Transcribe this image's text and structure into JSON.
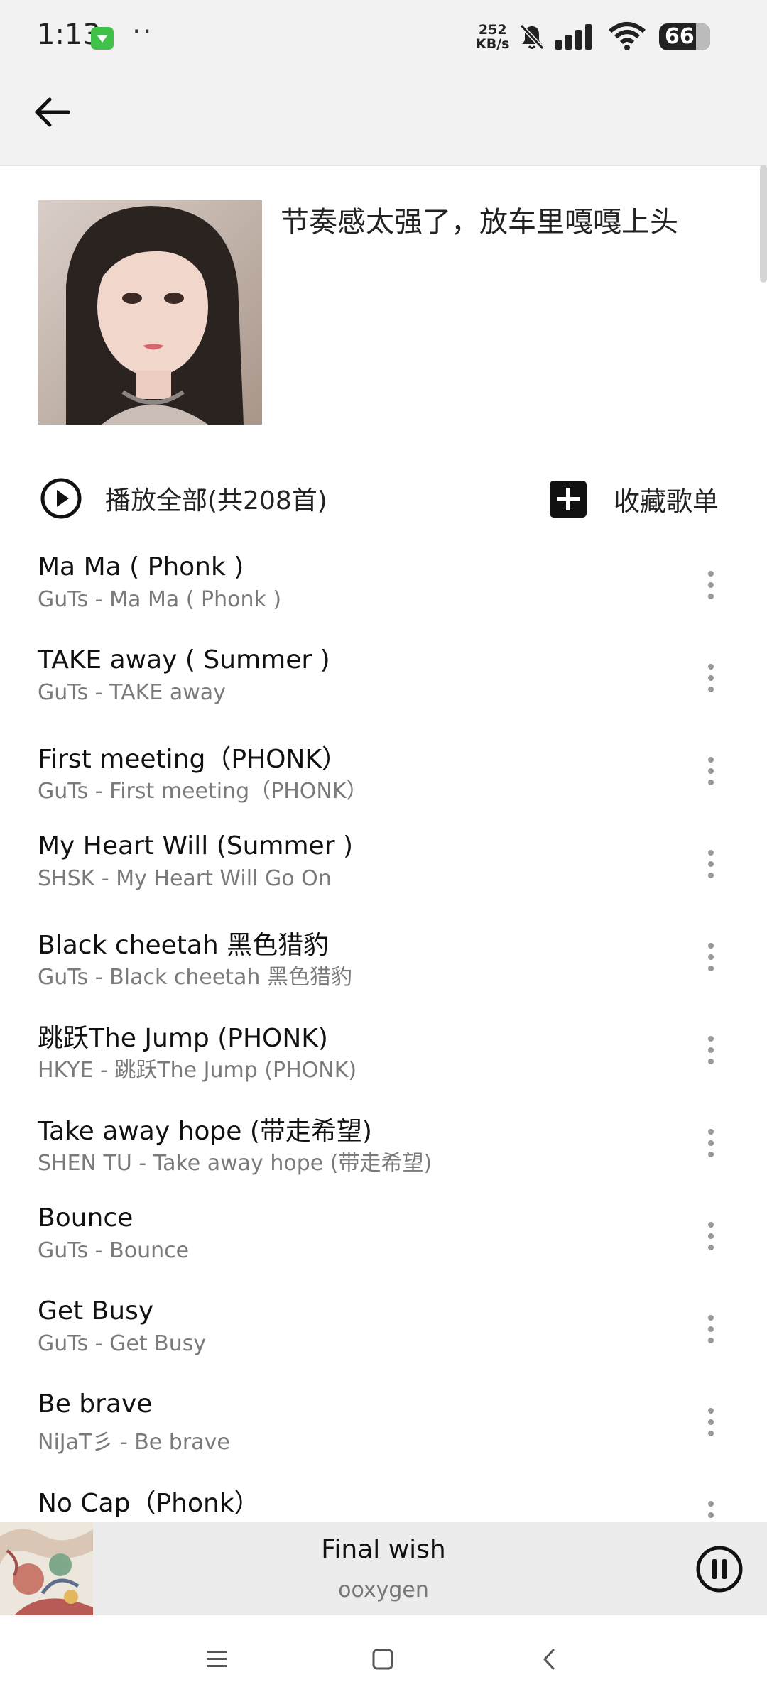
{
  "status_bar": {
    "time": "1:13",
    "dots": "··",
    "net_speed_value": "252",
    "net_speed_unit": "KB/s",
    "battery": "66"
  },
  "icons": {
    "back": "arrow-left-icon",
    "play_all": "play-circle-icon",
    "collect": "plus-square-icon",
    "more": "more-vertical-icon",
    "pause": "pause-circle-icon",
    "nav_menu": "menu-icon",
    "nav_home": "square-home-icon",
    "nav_back": "chevron-left-icon"
  },
  "playlist": {
    "title": "节奏感太强了，放车里嘎嘎上头",
    "play_all_label": "播放全部(共208首)",
    "collect_label": "收藏歌单"
  },
  "songs": [
    {
      "title": "Ma Ma ( Phonk )",
      "subtitle": "GuTs - Ma Ma ( Phonk )"
    },
    {
      "title": "TAKE away ( Summer )",
      "subtitle": "GuTs - TAKE away"
    },
    {
      "title": "First meeting（PHONK）",
      "subtitle": "GuTs - First meeting（PHONK）"
    },
    {
      "title": "My Heart Will (Summer )",
      "subtitle": "SHSK - My Heart Will Go On"
    },
    {
      "title": "Black cheetah 黑色猎豹",
      "subtitle": "GuTs - Black cheetah 黑色猎豹"
    },
    {
      "title": "跳跃The Jump (PHONK)",
      "subtitle": "HKYE - 跳跃The Jump (PHONK)"
    },
    {
      "title": "Take away hope (带走希望)",
      "subtitle": "SHEN TU - Take away hope (带走希望)"
    },
    {
      "title": "Bounce",
      "subtitle": "GuTs - Bounce"
    },
    {
      "title": "Get Busy",
      "subtitle": "GuTs - Get Busy"
    },
    {
      "title": "Be brave",
      "subtitle": "NiJaT彡 - Be brave"
    },
    {
      "title": "No Cap（Phonk）",
      "subtitle": ""
    }
  ],
  "now_playing": {
    "title": "Final wish",
    "artist": "ooxygen"
  },
  "colors": {
    "background": "#ffffff",
    "topbar": "#f2f2f2",
    "player": "#ececec",
    "subtitle": "#7a7a7a"
  }
}
